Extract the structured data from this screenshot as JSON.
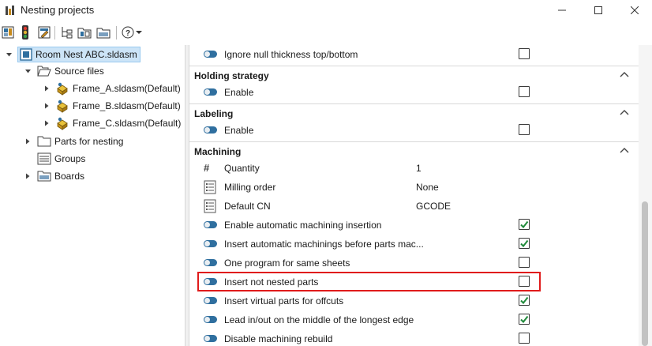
{
  "window": {
    "title": "Nesting projects",
    "controls": {
      "minimize": "minimize-icon",
      "maximize": "maximize-icon",
      "close": "close-icon"
    }
  },
  "toolbar": {
    "buttons": [
      "nesting-icon",
      "traffic-light-icon",
      "edit-project-icon",
      "tree-icon",
      "open-doc-icon",
      "folder-icon",
      "help-icon",
      "dropdown-arrow-icon"
    ]
  },
  "tree": {
    "root": "Room Nest ABC.sldasm",
    "source_files": "Source files",
    "files": [
      "Frame_A.sldasm(Default)",
      "Frame_B.sldasm(Default)",
      "Frame_C.sldasm(Default)"
    ],
    "parts_for_nesting": "Parts for nesting",
    "groups": "Groups",
    "boards": "Boards"
  },
  "grid": {
    "top_row": {
      "name": "Ignore null thickness top/bottom",
      "checked": false
    },
    "sections": {
      "holding": {
        "title": "Holding strategy",
        "enable": {
          "name": "Enable",
          "checked": false
        }
      },
      "labeling": {
        "title": "Labeling",
        "enable": {
          "name": "Enable",
          "checked": false
        }
      },
      "machining": {
        "title": "Machining",
        "quantity": {
          "name": "Quantity",
          "value": "1"
        },
        "milling_order": {
          "name": "Milling order",
          "value": "None"
        },
        "default_cn": {
          "name": "Default CN",
          "value": "GCODE"
        },
        "bool_rows": [
          {
            "name": "Enable automatic machining insertion",
            "checked": true
          },
          {
            "name": "Insert automatic machinings before parts mac...",
            "checked": true
          },
          {
            "name": "One program for same sheets",
            "checked": false
          },
          {
            "name": "Insert not nested parts",
            "checked": false
          },
          {
            "name": "Insert virtual parts for offcuts",
            "checked": true
          },
          {
            "name": "Lead in/out on the middle of the longest edge",
            "checked": true
          },
          {
            "name": "Disable machining rebuild",
            "checked": false
          }
        ]
      }
    }
  },
  "colors": {
    "accent": "#2f6f9f",
    "check_green": "#1f8a3a",
    "highlight_red": "#e01b1b",
    "selection": "#cce4f7"
  }
}
